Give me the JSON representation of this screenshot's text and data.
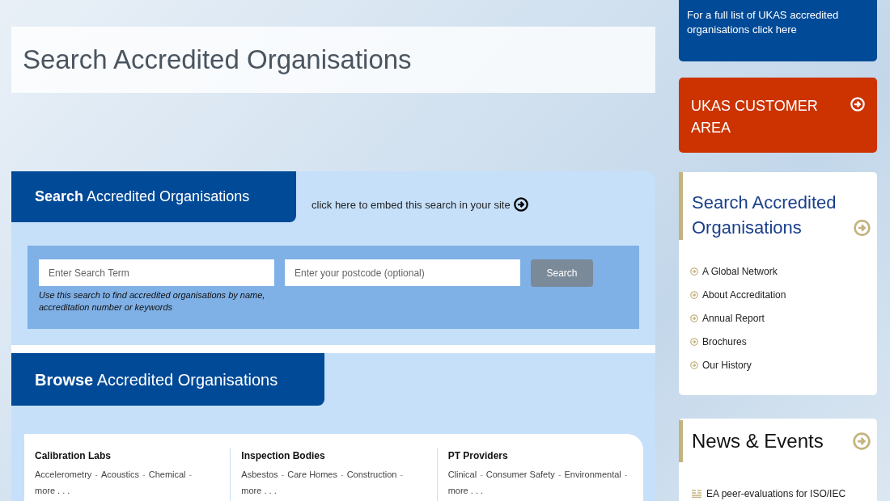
{
  "page_title": "Search Accredited Organisations",
  "search_panel": {
    "tab_title": "**Search** Accredited Organisations",
    "embed_link": "click here to embed this search in your site",
    "search_field": {
      "placeholder": "Enter Search Term"
    },
    "postcode_field": {
      "placeholder": "Enter your postcode (optional)"
    },
    "search_button": "Search",
    "hint": "Use this search to find accredited organisations by name, accreditation number or keywords"
  },
  "browse_panel": {
    "tab_title": "**Browse** Accredited Organisations",
    "separator": "-",
    "categories": [
      {
        "title": "Calibration Labs",
        "topics": [
          "Accelerometry",
          "Acoustics",
          "Chemical"
        ],
        "more": "more . . ."
      },
      {
        "title": "Inspection Bodies",
        "topics": [
          "Asbestos",
          "Care Homes",
          "Construction"
        ],
        "more": "more . . ."
      },
      {
        "title": "PT Providers",
        "topics": [
          "Clinical",
          "Consumer Safety",
          "Environmental"
        ],
        "more": "more . . ."
      }
    ]
  },
  "sidebar": {
    "full_list_link": "For a full list of UKAS accredited organisations click here",
    "customer_area": "UKAS CUSTOMER AREA",
    "search_card": {
      "title": "Search Accredited Organisations",
      "links": [
        "A Global Network",
        "About Accreditation",
        "Annual Report",
        "Brochures",
        "Our History"
      ]
    },
    "news_card": {
      "title": "News & Events",
      "items": [
        "EA peer-evaluations for ISO/IEC"
      ]
    }
  }
}
